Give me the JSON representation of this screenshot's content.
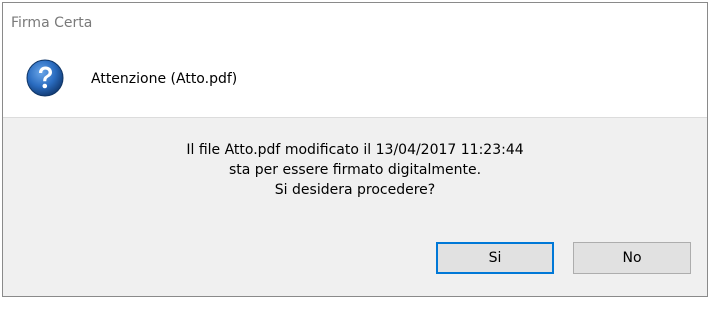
{
  "window": {
    "title": "Firma Certa"
  },
  "header": {
    "icon": "question-icon",
    "text": "Attenzione (Atto.pdf)"
  },
  "message": {
    "line1": "Il file Atto.pdf modificato il 13/04/2017 11:23:44",
    "line2": "sta per essere firmato digitalmente.",
    "line3": "Si desidera procedere?"
  },
  "buttons": {
    "yes_label": "Si",
    "no_label": "No"
  },
  "colors": {
    "icon_blue": "#1f5fa8",
    "default_button_border": "#0078d7",
    "body_background": "#f0f0f0"
  }
}
